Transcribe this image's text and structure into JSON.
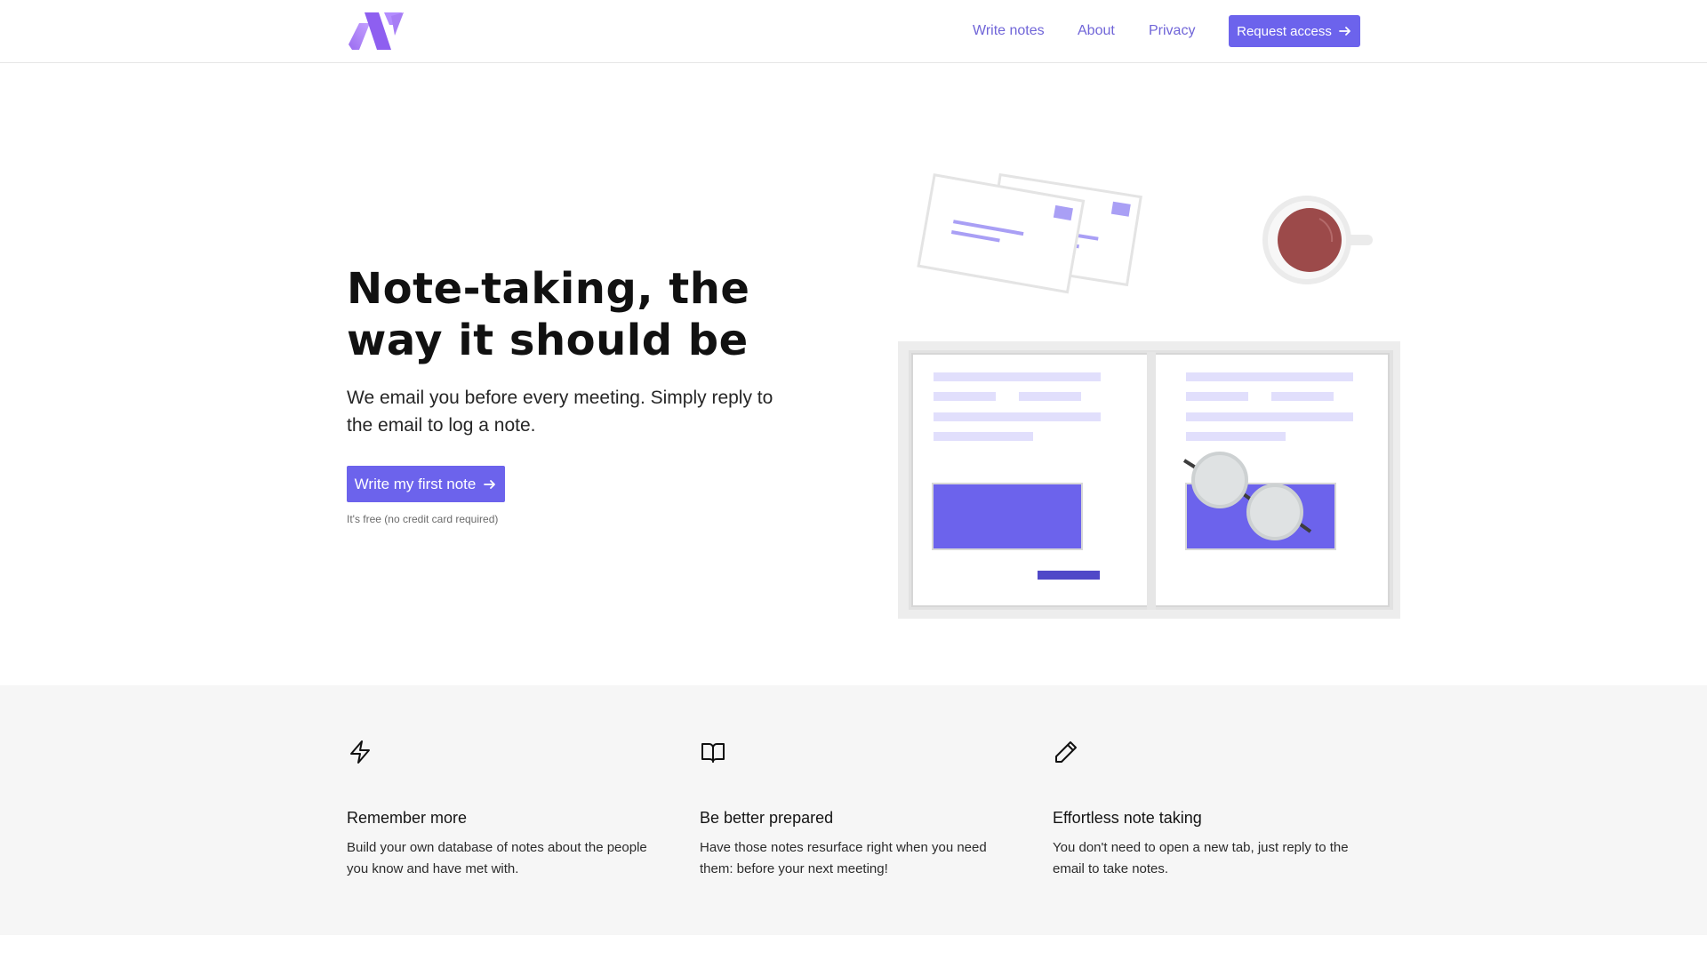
{
  "header": {
    "nav": {
      "write_notes": "Write notes",
      "about": "About",
      "privacy": "Privacy"
    },
    "request_access": "Request access"
  },
  "hero": {
    "title": "Note-taking, the way it should be",
    "subtitle": "We email you before every meeting. Simply reply to the email to log a note.",
    "cta": "Write my first note",
    "note": "It's free (no credit card required)"
  },
  "features": [
    {
      "icon": "lightning-icon",
      "title": "Remember more",
      "description": "Build your own database of notes about the people you know and have met with."
    },
    {
      "icon": "book-icon",
      "title": "Be better prepared",
      "description": "Have those notes resurface right when you need them: before your next meeting!"
    },
    {
      "icon": "pencil-icon",
      "title": "Effortless note taking",
      "description": "You don't need to open a new tab, just reply to the email to take notes."
    }
  ],
  "colors": {
    "accent": "#6c63ec",
    "nav_link": "#7065d8",
    "features_bg": "#f6f6f6"
  }
}
